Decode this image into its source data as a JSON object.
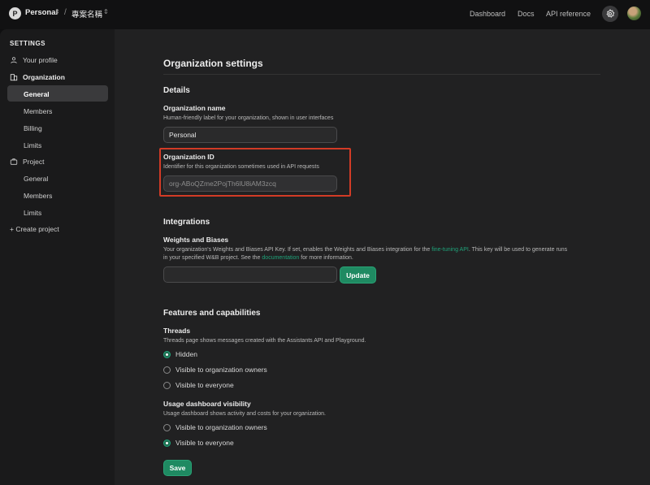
{
  "topbar": {
    "org_initial": "P",
    "org_name": "Personal",
    "separator": "/",
    "project_name": "專案名稱",
    "links": [
      "Dashboard",
      "Docs",
      "API reference"
    ]
  },
  "sidebar": {
    "heading": "SETTINGS",
    "your_profile": "Your profile",
    "organization": "Organization",
    "org_items": [
      "General",
      "Members",
      "Billing",
      "Limits"
    ],
    "project": "Project",
    "project_items": [
      "General",
      "Members",
      "Limits"
    ],
    "create_project": "+ Create project"
  },
  "main": {
    "title": "Organization settings",
    "details": {
      "title": "Details",
      "org_name_label": "Organization name",
      "org_name_desc": "Human-friendly label for your organization, shown in user interfaces",
      "org_name_value": "Personal",
      "org_id_label": "Organization ID",
      "org_id_desc": "Identifier for this organization sometimes used in API requests",
      "org_id_value": "org-ABoQZme2PojTh6lU8iAM3zcq"
    },
    "integrations": {
      "title": "Integrations",
      "wb_label": "Weights and Biases",
      "wb_desc_1": "Your organization's Weights and Biases API Key. If set, enables the Weights and Biases integration for the ",
      "wb_desc_link1": "fine-tuning API",
      "wb_desc_2": ". This key will be used to generate runs",
      "wb_desc_3": "in your specified W&B project. See the ",
      "wb_desc_link2": "documentation",
      "wb_desc_4": " for more information.",
      "wb_value": "",
      "update_label": "Update"
    },
    "features": {
      "title": "Features and capabilities",
      "threads_label": "Threads",
      "threads_desc": "Threads page shows messages created with the Assistants API and Playground.",
      "threads_options": [
        "Hidden",
        "Visible to organization owners",
        "Visible to everyone"
      ],
      "threads_selected": "Hidden",
      "usage_label": "Usage dashboard visibility",
      "usage_desc": "Usage dashboard shows activity and costs for your organization.",
      "usage_options": [
        "Visible to organization owners",
        "Visible to everyone"
      ],
      "usage_selected": "Visible to everyone",
      "save_label": "Save"
    }
  },
  "colors": {
    "accent": "#1f8a62",
    "highlight": "#d23b26",
    "link": "#1fa37a"
  }
}
